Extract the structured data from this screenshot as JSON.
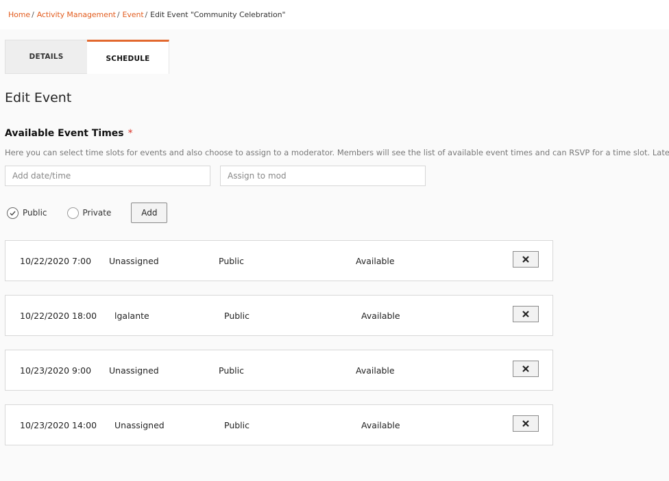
{
  "breadcrumb": {
    "items": [
      "Home",
      "Activity Management",
      "Event"
    ],
    "separator": "/",
    "current": "Edit Event \"Community Celebration\""
  },
  "tabs": [
    {
      "label": "DETAILS",
      "active": false
    },
    {
      "label": "SCHEDULE",
      "active": true
    }
  ],
  "page_title": "Edit Event",
  "section": {
    "label": "Available Event Times",
    "required_mark": "*",
    "help_text": "Here you can select time slots for events and also choose to assign to a moderator. Members will see the list of available event times and can RSVP for a time slot. Later, you can view"
  },
  "inputs": {
    "date_placeholder": "Add date/time",
    "mod_placeholder": "Assign to mod"
  },
  "visibility": {
    "public_label": "Public",
    "private_label": "Private",
    "selected": "Public"
  },
  "add_label": "Add",
  "slots": [
    {
      "datetime": "10/22/2020 7:00",
      "moderator": "Unassigned",
      "visibility": "Public",
      "status": "Available"
    },
    {
      "datetime": "10/22/2020 18:00",
      "moderator": "lgalante",
      "visibility": "Public",
      "status": "Available"
    },
    {
      "datetime": "10/23/2020 9:00",
      "moderator": "Unassigned",
      "visibility": "Public",
      "status": "Available"
    },
    {
      "datetime": "10/23/2020 14:00",
      "moderator": "Unassigned",
      "visibility": "Public",
      "status": "Available"
    }
  ],
  "icons": {
    "remove": "close-icon",
    "radio_checked": "check-icon"
  },
  "colors": {
    "accent": "#e25c1e",
    "required": "#d93025"
  }
}
